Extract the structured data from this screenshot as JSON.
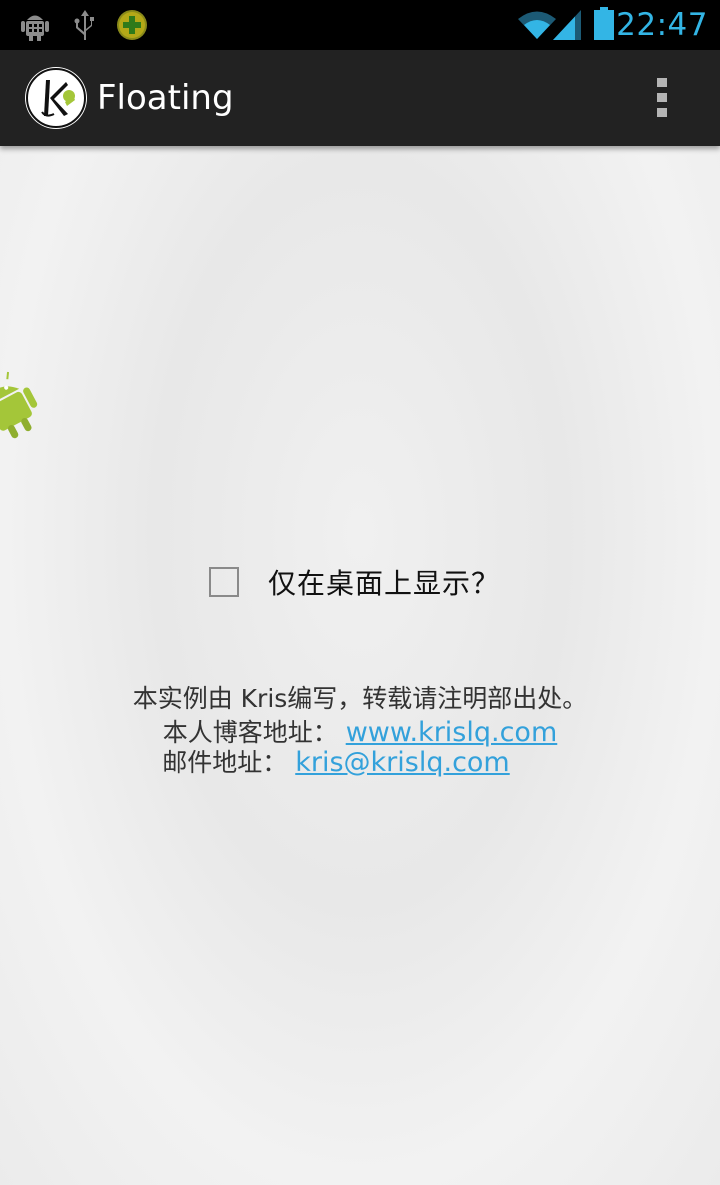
{
  "status_bar": {
    "time": "22:47",
    "time_color": "#33b5e5",
    "icons": [
      "android-debug-icon",
      "usb-icon",
      "app-notification-icon",
      "wifi-icon",
      "signal-icon",
      "battery-icon"
    ]
  },
  "action_bar": {
    "title": "Floating",
    "logo": "kris-logo-icon",
    "menu": "overflow-menu-icon"
  },
  "main": {
    "checkbox": {
      "label": "仅在桌面上显示？",
      "checked": false
    },
    "info": {
      "line1": "本实例由 Kris编写，转载请注明部出处。",
      "blog_label": "本人博客地址：",
      "blog_link": "www.krislq.com",
      "email_label": "邮件地址：",
      "email_link": "kris@krislq.com"
    },
    "floating_icon": "android-robot-icon"
  },
  "colors": {
    "accent": "#33b5e5",
    "link": "#33a1db",
    "action_bar": "#222222"
  }
}
